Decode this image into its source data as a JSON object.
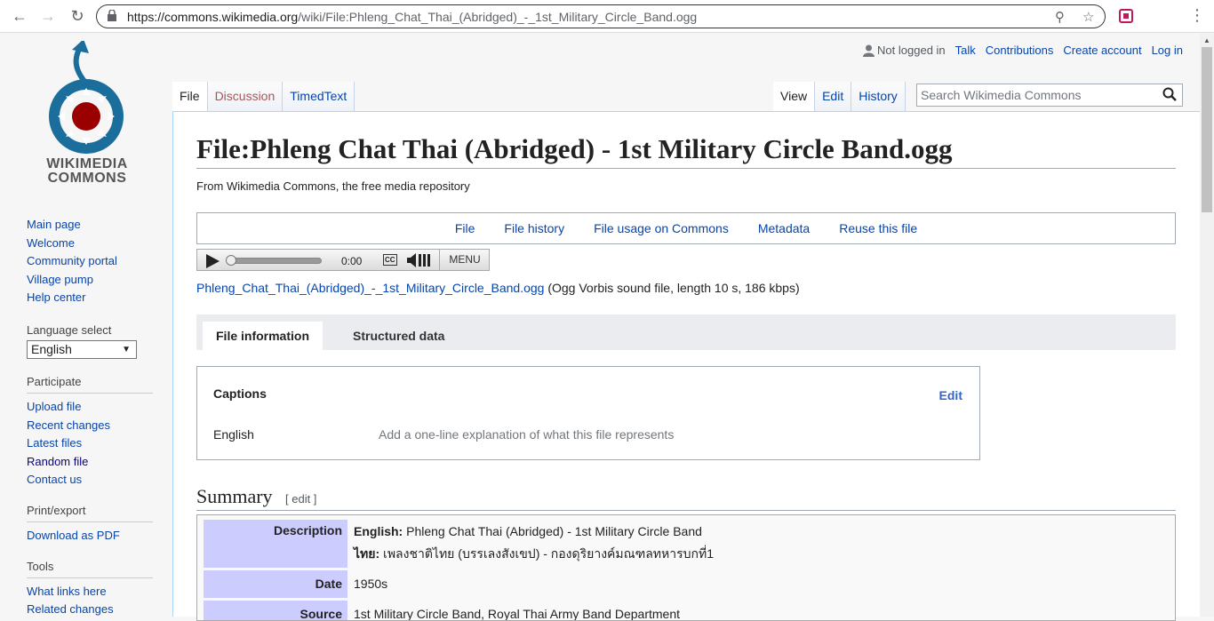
{
  "browser": {
    "url_host": "https://commons.wikimedia.org",
    "url_path": "/wiki/File:Phleng_Chat_Thai_(Abridged)_-_1st_Military_Circle_Band.ogg"
  },
  "logo": {
    "line1": "WIKIMEDIA",
    "line2": "COMMONS"
  },
  "sidebar": {
    "nav": [
      "Main page",
      "Welcome",
      "Community portal",
      "Village pump",
      "Help center"
    ],
    "language_heading": "Language select",
    "language_value": "English",
    "participate_heading": "Participate",
    "participate": [
      "Upload file",
      "Recent changes",
      "Latest files",
      "Random file",
      "Contact us"
    ],
    "print_heading": "Print/export",
    "print": [
      "Download as PDF"
    ],
    "tools_heading": "Tools",
    "tools": [
      "What links here",
      "Related changes"
    ]
  },
  "personal": {
    "not_logged_in": "Not logged in",
    "links": [
      "Talk",
      "Contributions",
      "Create account",
      "Log in"
    ]
  },
  "tabs": {
    "left": [
      "File",
      "Discussion",
      "TimedText"
    ],
    "right": [
      "View",
      "Edit",
      "History"
    ]
  },
  "search": {
    "placeholder": "Search Wikimedia Commons"
  },
  "page": {
    "title": "File:Phleng Chat Thai (Abridged) - 1st Military Circle Band.ogg",
    "tagline": "From Wikimedia Commons, the free media repository",
    "filetoc": [
      "File",
      "File history",
      "File usage on Commons",
      "Metadata",
      "Reuse this file"
    ]
  },
  "player": {
    "time": "0:00",
    "cc": "CC",
    "menu": "MENU"
  },
  "fileinfo": {
    "link": "Phleng_Chat_Thai_(Abridged)_-_1st_Military_Circle_Band.ogg",
    "desc": "(Ogg Vorbis sound file, length 10 s, 186 kbps)"
  },
  "media_tabs": {
    "active": "File information",
    "inactive": "Structured data"
  },
  "captions": {
    "heading": "Captions",
    "edit": "Edit",
    "language": "English",
    "placeholder": "Add a one-line explanation of what this file represents"
  },
  "summary": {
    "heading": "Summary",
    "edit": "[ edit ]",
    "rows": {
      "description_label": "Description",
      "description_en_label": "English:",
      "description_en": "Phleng Chat Thai (Abridged) - 1st Military Circle Band",
      "description_th_label": "ไทย:",
      "description_th": "เพลงชาติไทย (บรรเลงสังเขป) - กองดุริยางค์มณฑลทหารบกที่1",
      "date_label": "Date",
      "date": "1950s",
      "source_label": "Source",
      "source": "1st Military Circle Band, Royal Thai Army Band Department"
    }
  },
  "colors": {
    "link": "#0645ad",
    "visited": "#0b0080",
    "new_link": "#a55858",
    "label_bg": "#ccccff"
  }
}
